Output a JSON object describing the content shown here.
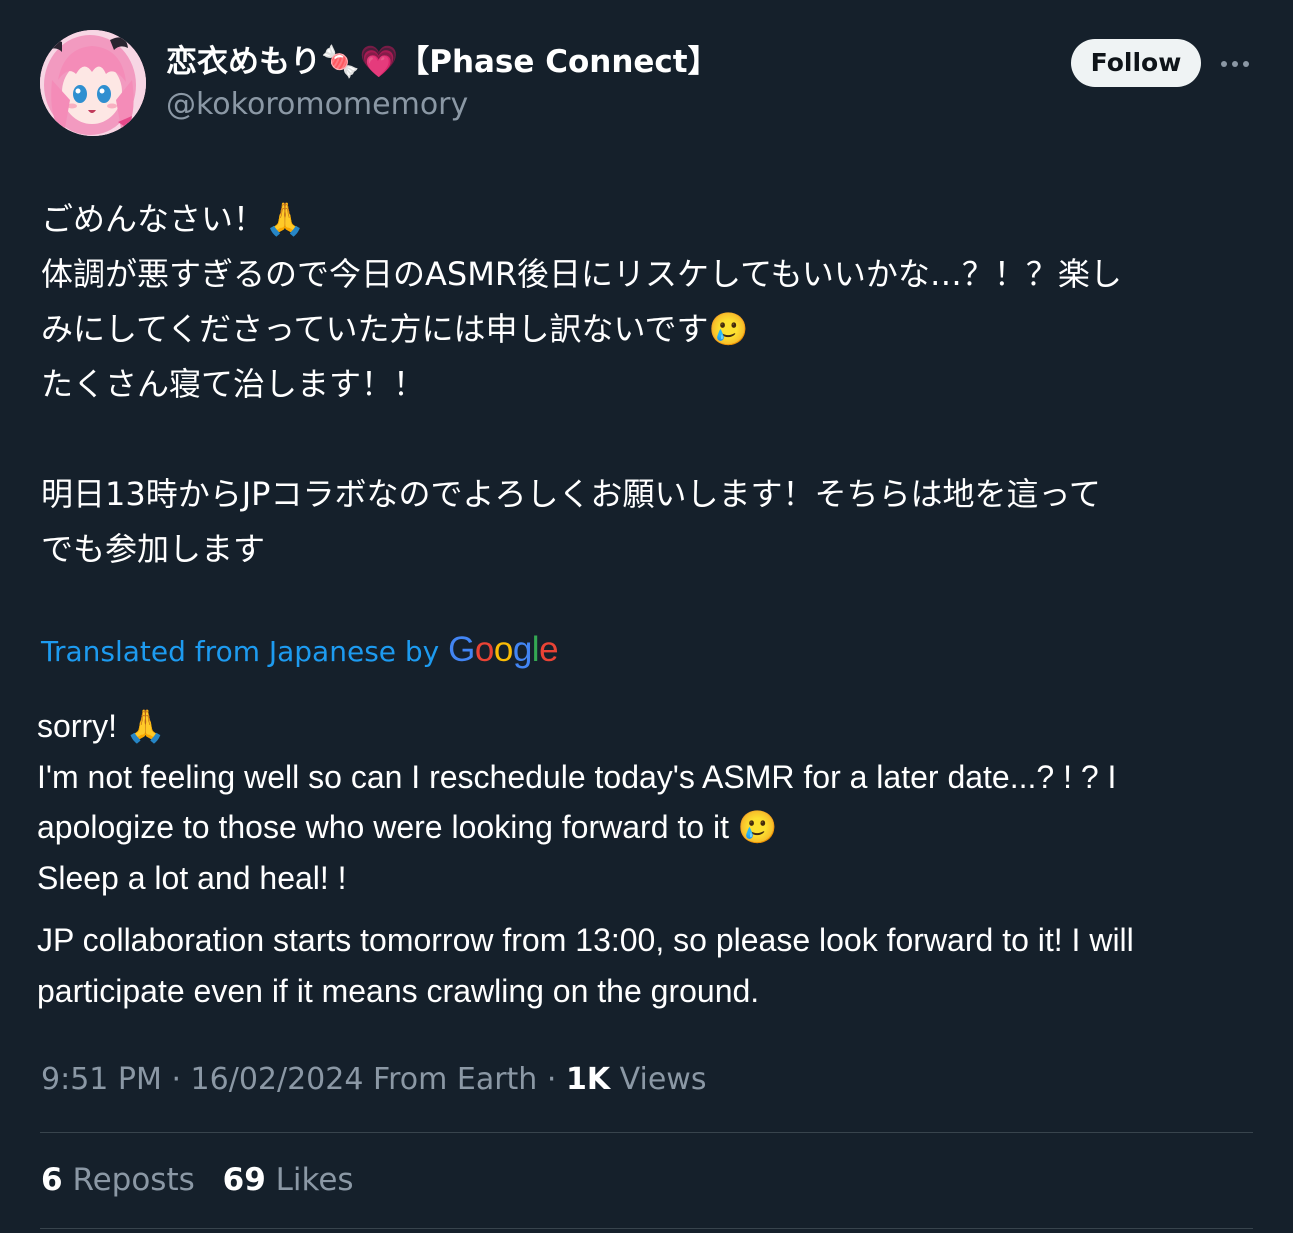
{
  "author": {
    "display_name_jp": "恋衣めもり",
    "candy_emoji": "🍬",
    "heart_emoji": "💗",
    "display_name_tag": "【Phase Connect】",
    "handle": "@kokoromomemory",
    "avatar_icon": "anime-avatar"
  },
  "actions": {
    "follow_label": "Follow",
    "more_icon": "more-dots-icon"
  },
  "original": {
    "line1": "ごめんなさい！🙏",
    "line2": "体調が悪すぎるので今日のASMR後日にリスケしてもいいかな…？！？楽し",
    "line3": "みにしてくださっていた方には申し訳ないです🥲",
    "line4": "たくさん寝て治します！！",
    "line5": "明日13時からJPコラボなのでよろしくお願いします！そちらは地を這って",
    "line6": "でも参加します"
  },
  "translation": {
    "translated_from_label": "Translated from Japanese by",
    "google_logo_text": "Google",
    "line1": "sorry! 🙏",
    "line2": "I'm not feeling well so can I reschedule today's ASMR for a later date...? ! ? I",
    "line3": "apologize to those who were looking forward to it 🥲",
    "line4": "Sleep a lot and heal! !",
    "line5": "JP collaboration starts tomorrow from 13:00, so please look forward to it! I will",
    "line6": "participate even if it means crawling on the ground."
  },
  "meta": {
    "time": "9:51 PM",
    "separator": "·",
    "date": "16/02/2024",
    "location": "From Earth",
    "views_count": "1K",
    "views_label": "Views"
  },
  "stats": {
    "reposts_count": "6",
    "reposts_label": "Reposts",
    "likes_count": "69",
    "likes_label": "Likes"
  },
  "colors": {
    "background": "#15202b",
    "link_blue": "#1d9bf0",
    "secondary_text": "#8b98a5",
    "divider": "#38444d",
    "follow_button_bg": "#eff3f4"
  }
}
